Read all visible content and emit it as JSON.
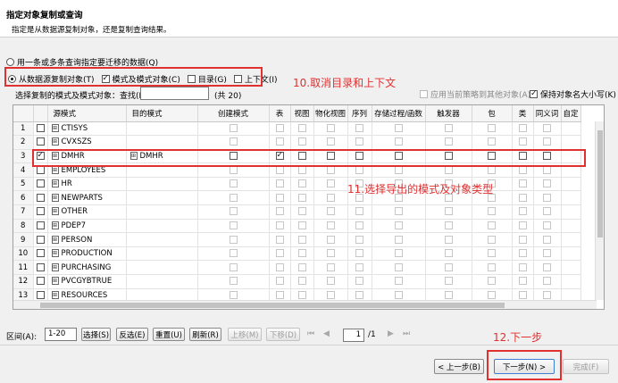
{
  "header": {
    "title": "指定对象复制或查询",
    "subtitle": "指定是从数据源复制对象，还是复制查询结果。"
  },
  "mode_query_label": "用一条或多条查询指定要迁移的数据(Q)",
  "mode_copy_label": "从数据源复制对象(T)",
  "options": {
    "schema_objects": "模式及模式对象(C)",
    "catalog": "目录(G)",
    "context": "上下文(I)"
  },
  "select_label": "选择复制的模式及模式对象：查找(F):",
  "search_value": "",
  "count_text": "(共 20)",
  "apply_other_label": "应用当前策略到其他对象(A)",
  "keep_case_label": "保持对象名大小写(K)",
  "columns": [
    "源模式",
    "目的模式",
    "创建模式",
    "表",
    "视图",
    "物化视图",
    "序列",
    "存储过程/函数",
    "触发器",
    "包",
    "类",
    "同义词",
    "自定"
  ],
  "rows": [
    {
      "num": "1",
      "src": "CTISYS",
      "dest": "",
      "checked": false
    },
    {
      "num": "2",
      "src": "CVXSZS",
      "dest": "",
      "checked": false
    },
    {
      "num": "3",
      "src": "DMHR",
      "dest": "DMHR",
      "checked": true
    },
    {
      "num": "4",
      "src": "EMPLOYEES",
      "dest": "",
      "checked": false
    },
    {
      "num": "5",
      "src": "HR",
      "dest": "",
      "checked": false
    },
    {
      "num": "6",
      "src": "NEWPARTS",
      "dest": "",
      "checked": false
    },
    {
      "num": "7",
      "src": "OTHER",
      "dest": "",
      "checked": false
    },
    {
      "num": "8",
      "src": "PDEP7",
      "dest": "",
      "checked": false
    },
    {
      "num": "9",
      "src": "PERSON",
      "dest": "",
      "checked": false
    },
    {
      "num": "10",
      "src": "PRODUCTION",
      "dest": "",
      "checked": false
    },
    {
      "num": "11",
      "src": "PURCHASING",
      "dest": "",
      "checked": false
    },
    {
      "num": "12",
      "src": "PVCGYBTRUE",
      "dest": "",
      "checked": false
    },
    {
      "num": "13",
      "src": "RESOURCES",
      "dest": "",
      "checked": false
    }
  ],
  "toolbar": {
    "range_label": "区间(A):",
    "range_value": "1-20",
    "select": "选择(S)",
    "invert": "反选(E)",
    "reset": "重置(U)",
    "refresh": "刷新(R)",
    "up": "上移(M)",
    "down": "下移(D)",
    "page_value": "1",
    "page_total": "/1"
  },
  "footer": {
    "prev": "< 上一步(B)",
    "next": "下一步(N) >",
    "finish": "完成(F)"
  },
  "annotations": {
    "a10": "10.取消目录和上下文",
    "a11": "11.选择导出的模式及对象类型",
    "a12": "12.下一步"
  },
  "colors": {
    "annotation": "#e03030"
  }
}
